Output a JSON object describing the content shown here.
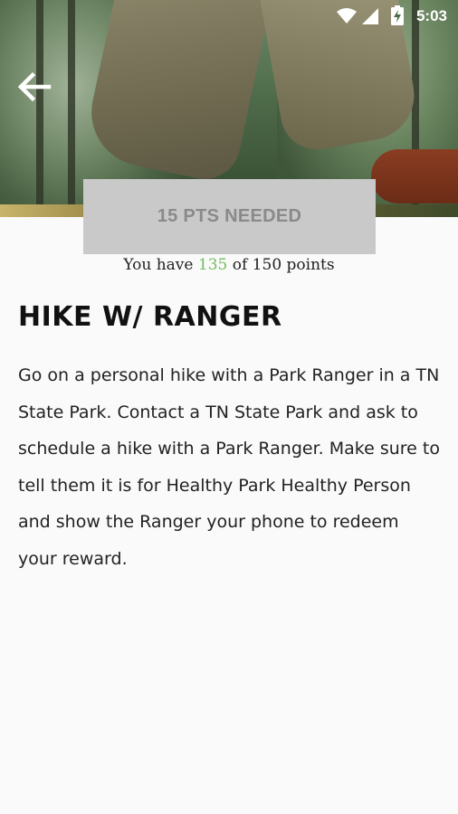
{
  "status_bar": {
    "time": "5:03"
  },
  "reward": {
    "button_label": "15 PTS NEEDED",
    "points_prefix": "You have",
    "points_have": "135",
    "points_suffix": "of 150 points",
    "title": "HIKE W/ RANGER",
    "description": "Go on a personal hike with a Park Ranger in a TN State Park. Contact a TN State Park and ask to schedule a hike with a Park Ranger. Make sure to tell them it is for Healthy Park Healthy Person and show the Ranger your phone to redeem your reward."
  },
  "colors": {
    "accent_green": "#6fbf5b",
    "disabled_button": "#c9c9c9"
  },
  "icons": {
    "back": "arrow-left-icon",
    "wifi": "wifi-icon",
    "signal": "signal-icon",
    "battery": "battery-charging-icon"
  }
}
